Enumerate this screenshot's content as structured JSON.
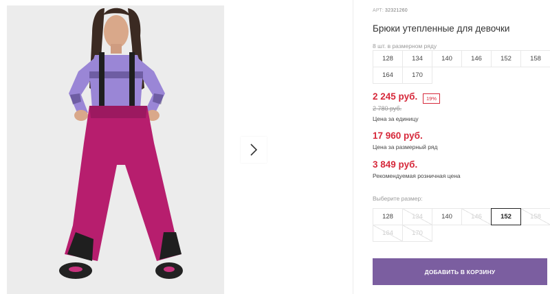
{
  "product": {
    "art_label": "АРТ:",
    "art_number": "32321260",
    "title": "Брюки утепленные для девочки"
  },
  "pack": {
    "label": "8 шт. в размерном ряду",
    "sizes": [
      "128",
      "134",
      "140",
      "146",
      "152",
      "158",
      "164",
      "170"
    ]
  },
  "prices": {
    "unit_price": "2 245 руб.",
    "discount": "19%",
    "old_price": "2 780 руб.",
    "unit_label": "Цена за единицу",
    "pack_price": "17 960 руб.",
    "pack_label": "Цена за размерный ряд",
    "retail_price": "3 849 руб.",
    "retail_label": "Рекомендуемая розничная цена"
  },
  "size_select": {
    "label": "Выберите размер:",
    "options": [
      {
        "size": "128",
        "state": "available"
      },
      {
        "size": "134",
        "state": "disabled"
      },
      {
        "size": "140",
        "state": "available"
      },
      {
        "size": "146",
        "state": "disabled"
      },
      {
        "size": "152",
        "state": "selected"
      },
      {
        "size": "158",
        "state": "disabled"
      },
      {
        "size": "164",
        "state": "disabled"
      },
      {
        "size": "170",
        "state": "disabled"
      }
    ]
  },
  "cart": {
    "add_label": "ДОБАВИТЬ В КОРЗИНУ"
  },
  "gallery": {
    "next_icon": "chevron-right-icon"
  },
  "colors": {
    "price_red": "#d6283a",
    "button_purple": "#7b5ea0",
    "pants_magenta": "#b71e6e",
    "top_lavender": "#9a86d6"
  }
}
